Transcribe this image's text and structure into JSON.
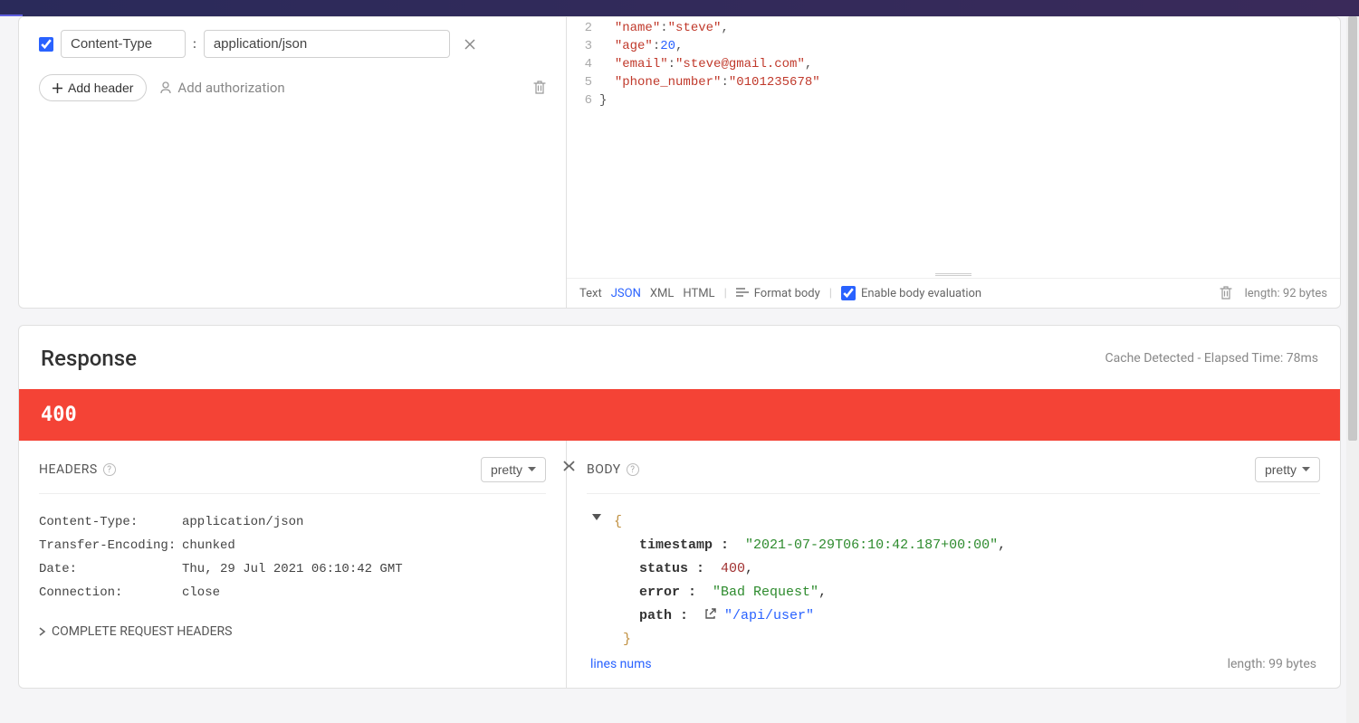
{
  "request": {
    "headers": [
      {
        "enabled": true,
        "name": "Content-Type",
        "value": "application/json"
      }
    ],
    "add_header_label": "Add header",
    "add_auth_label": "Add authorization",
    "body_lines": {
      "start": 2,
      "lines": [
        {
          "n": 2,
          "indent": "  ",
          "key": "name",
          "val": "steve",
          "type": "str",
          "trail": ","
        },
        {
          "n": 3,
          "indent": "  ",
          "key": "age",
          "val": "20",
          "type": "num",
          "trail": ","
        },
        {
          "n": 4,
          "indent": "  ",
          "key": "email",
          "val": "steve@gmail.com",
          "type": "str",
          "trail": ","
        },
        {
          "n": 5,
          "indent": "  ",
          "key": "phone_number",
          "val": "0101235678",
          "type": "str",
          "trail": ""
        },
        {
          "n": 6,
          "indent": "",
          "raw": "}"
        }
      ]
    },
    "body_types": {
      "text": "Text",
      "json": "JSON",
      "xml": "XML",
      "html": "HTML"
    },
    "format_btn": "Format body",
    "enable_eval": "Enable body evaluation",
    "length_label": "length: 92 bytes"
  },
  "response": {
    "title": "Response",
    "meta": "Cache Detected - Elapsed Time: 78ms",
    "status_code": "400",
    "headers_title": "HEADERS",
    "body_title": "BODY",
    "pretty_label": "pretty",
    "headers": [
      {
        "k": "Content-Type:",
        "v": "application/json"
      },
      {
        "k": "Transfer-Encoding:",
        "v": "chunked"
      },
      {
        "k": "Date:",
        "v": "Thu, 29 Jul 2021 06:10:42 GMT"
      },
      {
        "k": "Connection:",
        "v": "close"
      }
    ],
    "complete_headers_label": "COMPLETE REQUEST HEADERS",
    "body": {
      "timestamp": "2021-07-29T06:10:42.187+00:00",
      "status": 400,
      "error": "Bad Request",
      "path": "/api/user"
    },
    "lines_nums": "lines nums",
    "length_label": "length: 99 bytes"
  }
}
